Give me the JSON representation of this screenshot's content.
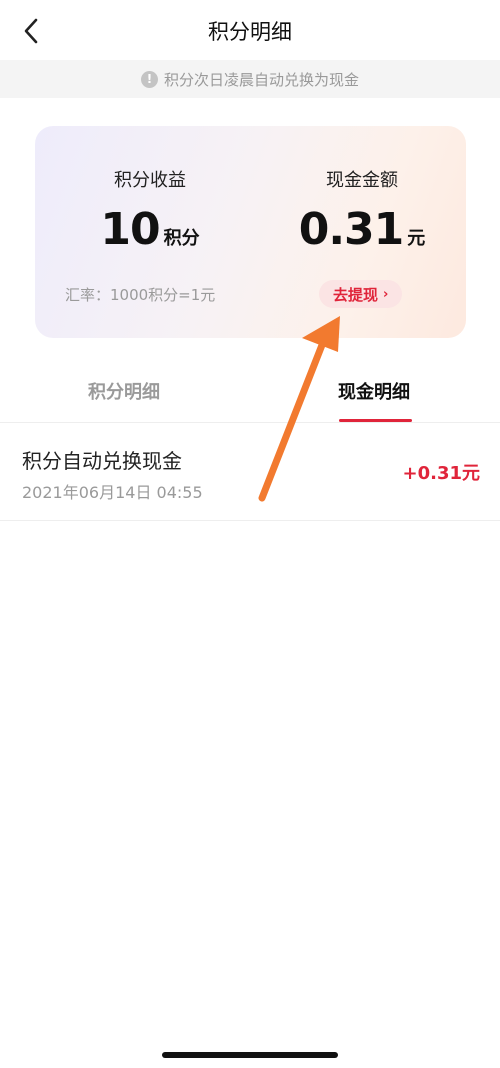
{
  "header": {
    "title": "积分明细"
  },
  "notice": {
    "icon": "!",
    "text": "积分次日凌晨自动兑换为现金"
  },
  "summary": {
    "points_label": "积分收益",
    "points_value": "10",
    "points_unit": "积分",
    "cash_label": "现金金额",
    "cash_value": "0.31",
    "cash_unit": "元",
    "rate_text": "汇率：1000积分=1元",
    "withdraw_label": "去提现",
    "withdraw_chevron": "›"
  },
  "tabs": [
    {
      "label": "积分明细",
      "active": false
    },
    {
      "label": "现金明细",
      "active": true
    }
  ],
  "records": [
    {
      "title": "积分自动兑换现金",
      "datetime": "2021年06月14日 04:55",
      "amount": "+0.31元"
    }
  ],
  "colors": {
    "accent": "#e0243a",
    "annotation_arrow": "#f27a2f"
  }
}
